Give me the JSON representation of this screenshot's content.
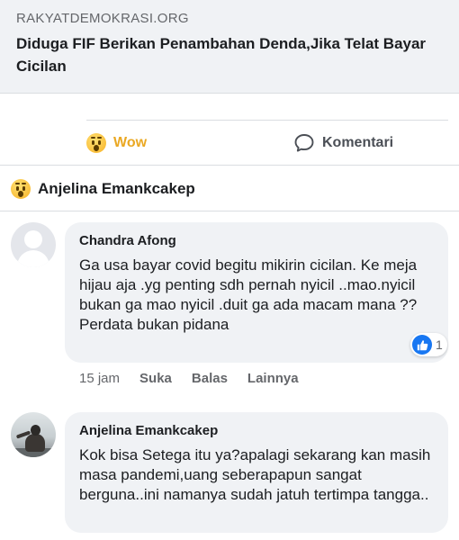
{
  "link_preview": {
    "domain": "RAKYATDEMOKRASI.ORG",
    "title": "Diduga FIF Berikan Penambahan Denda,Jika Telat Bayar Cicilan"
  },
  "actions": {
    "wow_label": "Wow",
    "wow_color": "#eaa823",
    "comment_label": "Komentari"
  },
  "reactor": {
    "name": "Anjelina Emankcakep",
    "reaction_icon": "wow-emoji-icon"
  },
  "comments": [
    {
      "author": "Chandra Afong",
      "text": "Ga usa bayar covid begitu mikirin cicilan. Ke meja hijau aja .yg penting sdh pernah nyicil ..mao.nyicil bukan ga mao nyicil .duit ga ada macam mana ?? Perdata bukan pidana",
      "like_count": "1",
      "time": "15 jam",
      "like_action": "Suka",
      "reply_action": "Balas",
      "more_action": "Lainnya"
    },
    {
      "author": "Anjelina Emankcakep",
      "text": "Kok bisa Setega itu ya?apalagi sekarang kan masih masa pandemi,uang seberapapun sangat berguna..ini namanya sudah jatuh tertimpa tangga.."
    }
  ],
  "colors": {
    "like_blue": "#1877f2",
    "bubble_bg": "#f0f2f5"
  }
}
